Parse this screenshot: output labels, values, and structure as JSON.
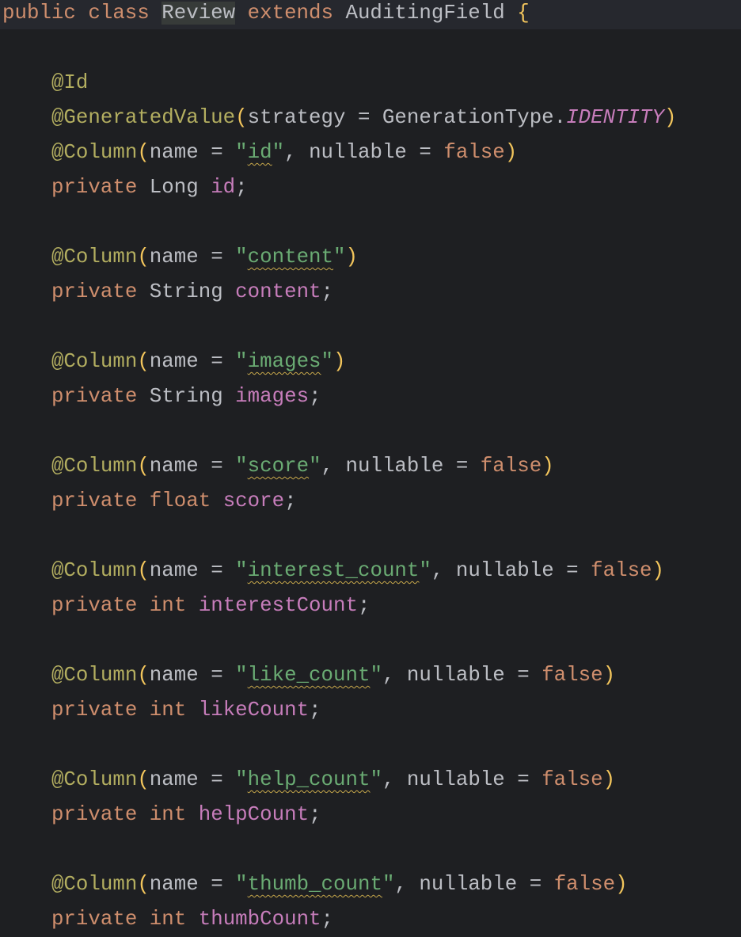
{
  "editor": {
    "lines": [
      [
        [
          "public class ",
          "kw"
        ],
        [
          "Review",
          "sel"
        ],
        [
          " extends ",
          "kw"
        ],
        [
          "AuditingField ",
          "tx"
        ],
        [
          "{",
          "br"
        ]
      ],
      [],
      [
        [
          "    ",
          "tx"
        ],
        [
          "@Id",
          "an"
        ]
      ],
      [
        [
          "    ",
          "tx"
        ],
        [
          "@GeneratedValue",
          "an"
        ],
        [
          "(",
          "br"
        ],
        [
          "strategy = GenerationType.",
          "tx"
        ],
        [
          "IDENTITY",
          "it"
        ],
        [
          ")",
          "br"
        ]
      ],
      [
        [
          "    ",
          "tx"
        ],
        [
          "@Column",
          "an"
        ],
        [
          "(",
          "br"
        ],
        [
          "name = ",
          "tx"
        ],
        [
          "\"",
          "st"
        ],
        [
          "id",
          "sq"
        ],
        [
          "\"",
          "st"
        ],
        [
          ", nullable = ",
          "tx"
        ],
        [
          "false",
          "kw"
        ],
        [
          ")",
          "br"
        ]
      ],
      [
        [
          "    ",
          "tx"
        ],
        [
          "private ",
          "kw"
        ],
        [
          "Long ",
          "tx"
        ],
        [
          "id",
          "fd"
        ],
        [
          ";",
          "tx"
        ]
      ],
      [],
      [
        [
          "    ",
          "tx"
        ],
        [
          "@Column",
          "an"
        ],
        [
          "(",
          "br"
        ],
        [
          "name = ",
          "tx"
        ],
        [
          "\"",
          "st"
        ],
        [
          "content",
          "sq"
        ],
        [
          "\"",
          "st"
        ],
        [
          ")",
          "br"
        ]
      ],
      [
        [
          "    ",
          "tx"
        ],
        [
          "private ",
          "kw"
        ],
        [
          "String ",
          "tx"
        ],
        [
          "content",
          "fd"
        ],
        [
          ";",
          "tx"
        ]
      ],
      [],
      [
        [
          "    ",
          "tx"
        ],
        [
          "@Column",
          "an"
        ],
        [
          "(",
          "br"
        ],
        [
          "name = ",
          "tx"
        ],
        [
          "\"",
          "st"
        ],
        [
          "images",
          "sq"
        ],
        [
          "\"",
          "st"
        ],
        [
          ")",
          "br"
        ]
      ],
      [
        [
          "    ",
          "tx"
        ],
        [
          "private ",
          "kw"
        ],
        [
          "String ",
          "tx"
        ],
        [
          "images",
          "fd"
        ],
        [
          ";",
          "tx"
        ]
      ],
      [],
      [
        [
          "    ",
          "tx"
        ],
        [
          "@Column",
          "an"
        ],
        [
          "(",
          "br"
        ],
        [
          "name = ",
          "tx"
        ],
        [
          "\"",
          "st"
        ],
        [
          "score",
          "sq"
        ],
        [
          "\"",
          "st"
        ],
        [
          ", nullable = ",
          "tx"
        ],
        [
          "false",
          "kw"
        ],
        [
          ")",
          "br"
        ]
      ],
      [
        [
          "    ",
          "tx"
        ],
        [
          "private ",
          "kw"
        ],
        [
          "float ",
          "kw"
        ],
        [
          "score",
          "fd"
        ],
        [
          ";",
          "tx"
        ]
      ],
      [],
      [
        [
          "    ",
          "tx"
        ],
        [
          "@Column",
          "an"
        ],
        [
          "(",
          "br"
        ],
        [
          "name = ",
          "tx"
        ],
        [
          "\"",
          "st"
        ],
        [
          "interest_count",
          "sq"
        ],
        [
          "\"",
          "st"
        ],
        [
          ", nullable = ",
          "tx"
        ],
        [
          "false",
          "kw"
        ],
        [
          ")",
          "br"
        ]
      ],
      [
        [
          "    ",
          "tx"
        ],
        [
          "private ",
          "kw"
        ],
        [
          "int ",
          "kw"
        ],
        [
          "interestCount",
          "fd"
        ],
        [
          ";",
          "tx"
        ]
      ],
      [],
      [
        [
          "    ",
          "tx"
        ],
        [
          "@Column",
          "an"
        ],
        [
          "(",
          "br"
        ],
        [
          "name = ",
          "tx"
        ],
        [
          "\"",
          "st"
        ],
        [
          "like_count",
          "sq"
        ],
        [
          "\"",
          "st"
        ],
        [
          ", nullable = ",
          "tx"
        ],
        [
          "false",
          "kw"
        ],
        [
          ")",
          "br"
        ]
      ],
      [
        [
          "    ",
          "tx"
        ],
        [
          "private ",
          "kw"
        ],
        [
          "int ",
          "kw"
        ],
        [
          "likeCount",
          "fd"
        ],
        [
          ";",
          "tx"
        ]
      ],
      [],
      [
        [
          "    ",
          "tx"
        ],
        [
          "@Column",
          "an"
        ],
        [
          "(",
          "br"
        ],
        [
          "name = ",
          "tx"
        ],
        [
          "\"",
          "st"
        ],
        [
          "help_count",
          "sq"
        ],
        [
          "\"",
          "st"
        ],
        [
          ", nullable = ",
          "tx"
        ],
        [
          "false",
          "kw"
        ],
        [
          ")",
          "br"
        ]
      ],
      [
        [
          "    ",
          "tx"
        ],
        [
          "private ",
          "kw"
        ],
        [
          "int ",
          "kw"
        ],
        [
          "helpCount",
          "fd"
        ],
        [
          ";",
          "tx"
        ]
      ],
      [],
      [
        [
          "    ",
          "tx"
        ],
        [
          "@Column",
          "an"
        ],
        [
          "(",
          "br"
        ],
        [
          "name = ",
          "tx"
        ],
        [
          "\"",
          "st"
        ],
        [
          "thumb_count",
          "sq"
        ],
        [
          "\"",
          "st"
        ],
        [
          ", nullable = ",
          "tx"
        ],
        [
          "false",
          "kw"
        ],
        [
          ")",
          "br"
        ]
      ],
      [
        [
          "    ",
          "tx"
        ],
        [
          "private ",
          "kw"
        ],
        [
          "int ",
          "kw"
        ],
        [
          "thumbCount",
          "fd"
        ],
        [
          ";",
          "tx"
        ]
      ]
    ]
  },
  "colors": {
    "background": "#1E1F22",
    "keyword": "#CF8E6D",
    "annotation": "#B3AE60",
    "string": "#6AAB73",
    "field": "#C77DBB",
    "text": "#BCBEC4",
    "bracket": "#F2C55C"
  }
}
